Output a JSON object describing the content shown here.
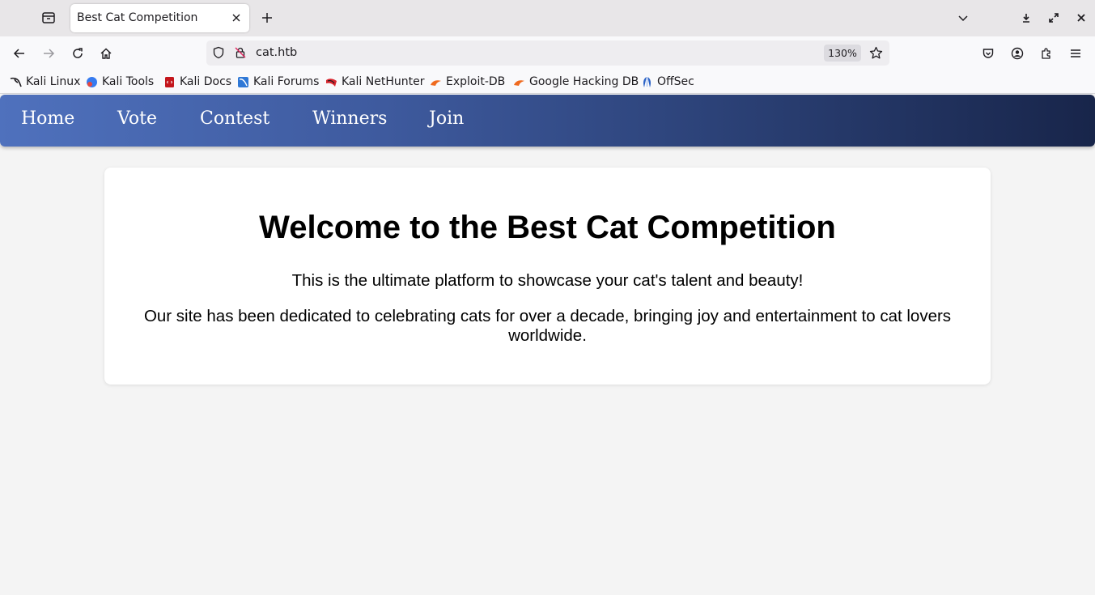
{
  "browser": {
    "tab": {
      "title": "Best Cat Competition"
    },
    "url": "cat.htb",
    "zoom": "130%",
    "bookmarks": [
      {
        "label": "Kali Linux",
        "icon": "kali-dragon-icon"
      },
      {
        "label": "Kali Tools",
        "icon": "kali-tools-icon"
      },
      {
        "label": "Kali Docs",
        "icon": "kali-docs-icon"
      },
      {
        "label": "Kali Forums",
        "icon": "kali-forums-icon"
      },
      {
        "label": "Kali NetHunter",
        "icon": "kali-nethunter-icon"
      },
      {
        "label": "Exploit-DB",
        "icon": "exploit-db-icon"
      },
      {
        "label": "Google Hacking DB",
        "icon": "ghdb-icon"
      },
      {
        "label": "OffSec",
        "icon": "offsec-icon"
      }
    ]
  },
  "site": {
    "nav": [
      "Home",
      "Vote",
      "Contest",
      "Winners",
      "Join"
    ],
    "heading": "Welcome to the Best Cat Competition",
    "intro": "This is the ultimate platform to showcase your cat's talent and beauty!",
    "about": "Our site has been dedicated to celebrating cats for over a decade, bringing joy and entertainment to cat lovers worldwide."
  },
  "colors": {
    "nav_gradient_start": "#4f71bd",
    "nav_gradient_end": "#18254a",
    "page_background": "#f4f4f4",
    "card_background": "#ffffff"
  }
}
